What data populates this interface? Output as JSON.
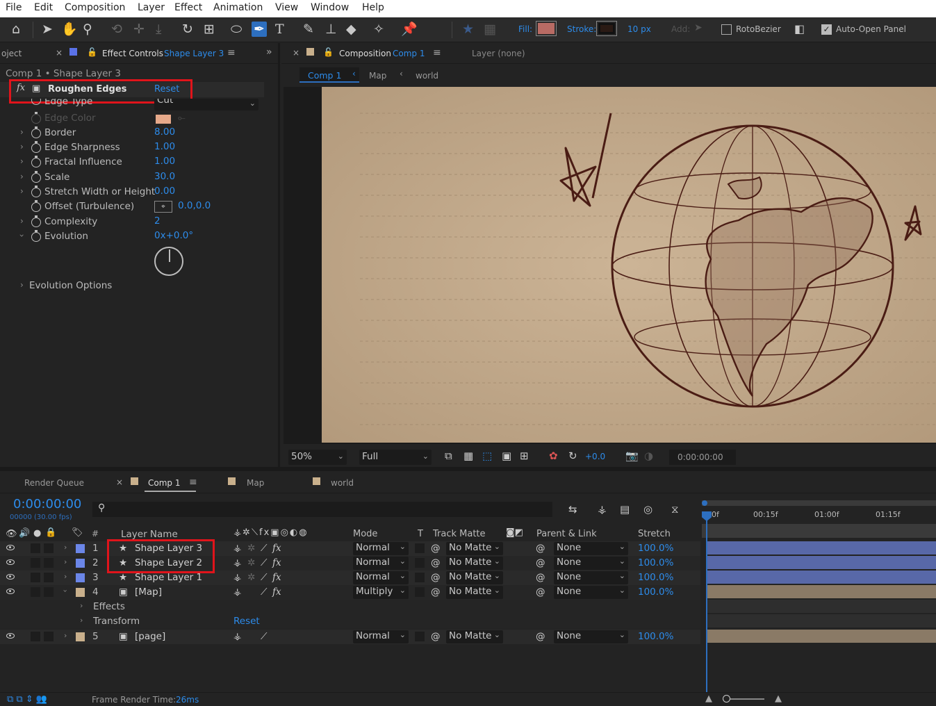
{
  "menu": [
    "File",
    "Edit",
    "Composition",
    "Layer",
    "Effect",
    "Animation",
    "View",
    "Window",
    "Help"
  ],
  "toolbar": {
    "fill_label": "Fill:",
    "stroke_label": "Stroke:",
    "stroke_width": "10 px",
    "add_label": "Add:",
    "rotobezier": "RotoBezier",
    "auto_open": "Auto-Open Panel",
    "fill_color": "#b86b64",
    "stroke_color": "#2a1a14"
  },
  "effect_panel": {
    "project_tab": "oject",
    "tab_label": "Effect Controls",
    "tab_layer": "Shape Layer 3",
    "breadcrumb": "Comp 1 • Shape Layer 3",
    "effect_name": "Roughen Edges",
    "reset": "Reset",
    "props": [
      {
        "name": "Edge Type",
        "value": "Cut"
      },
      {
        "name": "Edge Color",
        "value": ""
      },
      {
        "name": "Border",
        "value": "8.00"
      },
      {
        "name": "Edge Sharpness",
        "value": "1.00"
      },
      {
        "name": "Fractal Influence",
        "value": "1.00"
      },
      {
        "name": "Scale",
        "value": "30.0"
      },
      {
        "name": "Stretch Width or Height",
        "value": "0.00"
      },
      {
        "name": "Offset (Turbulence)",
        "value": "0.0,0.0"
      },
      {
        "name": "Complexity",
        "value": "2"
      },
      {
        "name": "Evolution",
        "value": "0x+0.0°"
      },
      {
        "name": "Evolution Options",
        "value": ""
      }
    ],
    "edge_color": "#e6a98a"
  },
  "comp_panel": {
    "tab_label": "Composition",
    "tab_comp": "Comp 1",
    "layer_tab": "Layer (none)",
    "crumbs": [
      "Comp 1",
      "Map",
      "world"
    ],
    "zoom": "50%",
    "resolution": "Full",
    "exposure": "+0.0",
    "timecode": "0:00:00:00"
  },
  "timeline": {
    "tabs": [
      "Render Queue",
      "Comp 1",
      "Map",
      "world"
    ],
    "timecode": "0:00:00:00",
    "frame_info": "00000 (30.00 fps)",
    "search_placeholder": "",
    "ruler": [
      "00f",
      "00:15f",
      "01:00f",
      "01:15f"
    ],
    "headers": {
      "num": "#",
      "layer_name": "Layer Name",
      "mode": "Mode",
      "t": "T",
      "track_matte": "Track Matte",
      "parent": "Parent & Link",
      "stretch": "Stretch"
    },
    "layers": [
      {
        "num": "1",
        "name": "Shape Layer 3",
        "mode": "Normal",
        "matte": "No Matte",
        "parent": "None",
        "stretch": "100.0%"
      },
      {
        "num": "2",
        "name": "Shape Layer 2",
        "mode": "Normal",
        "matte": "No Matte",
        "parent": "None",
        "stretch": "100.0%"
      },
      {
        "num": "3",
        "name": "Shape Layer 1",
        "mode": "Normal",
        "matte": "No Matte",
        "parent": "None",
        "stretch": "100.0%"
      },
      {
        "num": "4",
        "name": "[Map]",
        "mode": "Multiply",
        "matte": "No Matte",
        "parent": "None",
        "stretch": "100.0%"
      },
      {
        "num": "5",
        "name": "[page]",
        "mode": "Normal",
        "matte": "No Matte",
        "parent": "None",
        "stretch": "100.0%"
      }
    ],
    "sub_effects": "Effects",
    "sub_transform": "Transform",
    "sub_reset": "Reset",
    "frame_render_label": "Frame Render Time:",
    "frame_render_value": "26ms"
  }
}
